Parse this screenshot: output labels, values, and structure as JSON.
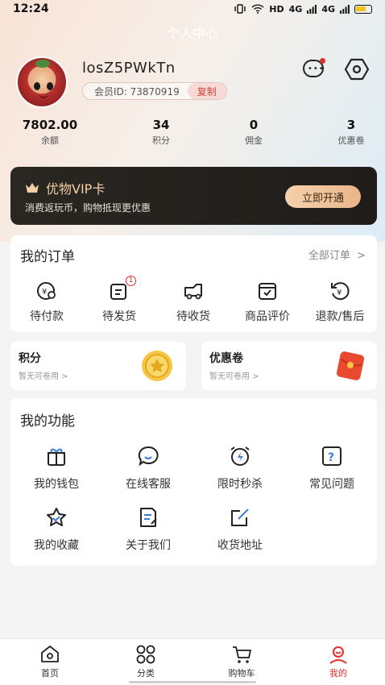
{
  "status_bar": {
    "time": "12:24",
    "network": "HD",
    "signal_1": "4G",
    "signal_2": "4G"
  },
  "page_title": "个人中心",
  "profile": {
    "username": "losZ5PWkTn",
    "member_id": "会员ID: 73870919",
    "copy_label": "复制"
  },
  "stats": [
    {
      "value": "7802.00",
      "label": "余额"
    },
    {
      "value": "34",
      "label": "积分"
    },
    {
      "value": "0",
      "label": "佣金"
    },
    {
      "value": "3",
      "label": "优惠卷"
    }
  ],
  "vip": {
    "title": "优物VIP卡",
    "subtitle": "消费返玩币，购物抵现更优惠",
    "button": "立即开通"
  },
  "orders": {
    "title": "我的订单",
    "all_label": "全部订单",
    "items": [
      {
        "label": "待付款",
        "icon": "payment-icon"
      },
      {
        "label": "待发货",
        "icon": "to-ship-icon",
        "badge": "1"
      },
      {
        "label": "待收货",
        "icon": "truck-icon"
      },
      {
        "label": "商品评价",
        "icon": "review-icon"
      },
      {
        "label": "退款/售后",
        "icon": "refund-icon"
      }
    ]
  },
  "points_card": {
    "title": "积分",
    "subtitle": "暂无可卷用 >"
  },
  "coupon_card": {
    "title": "优惠卷",
    "subtitle": "暂无可卷用 >"
  },
  "features": {
    "title": "我的功能",
    "items": [
      {
        "label": "我的钱包",
        "icon": "gift-wallet-icon"
      },
      {
        "label": "在线客服",
        "icon": "chat-service-icon"
      },
      {
        "label": "限时秒杀",
        "icon": "alarm-clock-icon"
      },
      {
        "label": "常见问题",
        "icon": "question-icon"
      },
      {
        "label": "我的收藏",
        "icon": "star-icon"
      },
      {
        "label": "关于我们",
        "icon": "about-icon"
      },
      {
        "label": "收货地址",
        "icon": "edit-address-icon"
      }
    ]
  },
  "tabbar": [
    {
      "label": "首页",
      "icon": "home-icon"
    },
    {
      "label": "分类",
      "icon": "category-icon"
    },
    {
      "label": "购物车",
      "icon": "cart-icon"
    },
    {
      "label": "我的",
      "icon": "profile-icon",
      "active": true
    }
  ],
  "colors": {
    "accent": "#e0302a",
    "vip_gold": "#f3cfa6",
    "vip_bg": "#1f1c19"
  }
}
